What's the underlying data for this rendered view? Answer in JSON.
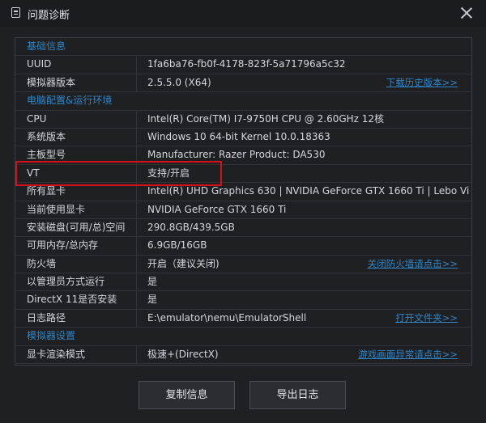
{
  "window": {
    "title": "问题诊断",
    "icon": "document-icon"
  },
  "sections": {
    "basic": "基础信息",
    "env": "电脑配置&运行环境",
    "emu": "模拟器设置"
  },
  "rows": {
    "uuid": {
      "label": "UUID",
      "value": "1fa6ba76-fb0f-4178-823f-5a71796a5c32"
    },
    "emu_version": {
      "label": "模拟器版本",
      "value": "2.5.5.0 (X64)",
      "link": "下载历史版本>>"
    },
    "cpu": {
      "label": "CPU",
      "value": "Intel(R) Core(TM) I7-9750H CPU @ 2.60GHz 12核"
    },
    "os": {
      "label": "系统版本",
      "value": "Windows 10 64-bit Kernel 10.0.18363"
    },
    "board": {
      "label": "主板型号",
      "value": "Manufacturer: Razer  Product: DA530"
    },
    "vt": {
      "label": "VT",
      "value": "支持/开启"
    },
    "all_gpu": {
      "label": "所有显卡",
      "value": "Intel(R) UHD Graphics 630 | NVIDIA GeForce GTX 1660 Ti | Lebo Vi"
    },
    "cur_gpu": {
      "label": "当前使用显卡",
      "value": "NVIDIA GeForce GTX 1660 Ti"
    },
    "disk": {
      "label": "安装磁盘(可用/总)空间",
      "value": "290.8GB/439.5GB"
    },
    "mem": {
      "label": "可用内存/总内存",
      "value": "6.9GB/16GB"
    },
    "firewall": {
      "label": "防火墙",
      "value": "开启（建议关闭)",
      "link": "关闭防火墙请点击>>"
    },
    "admin": {
      "label": "以管理员方式运行",
      "value": "是"
    },
    "dx11": {
      "label": "DirectX 11是否安装",
      "value": "是"
    },
    "log": {
      "label": "日志路径",
      "value": "E:\\emulator\\nemu\\EmulatorShell",
      "link": "打开文件夹>>"
    },
    "render": {
      "label": "显卡渲染模式",
      "value": "极速+(DirectX)",
      "link": "游戏画面异常请点击>>"
    }
  },
  "buttons": {
    "copy": "复制信息",
    "export": "导出日志"
  },
  "colors": {
    "accent": "#2f86c9",
    "highlight": "#d6101a",
    "background": "#1f2022"
  }
}
